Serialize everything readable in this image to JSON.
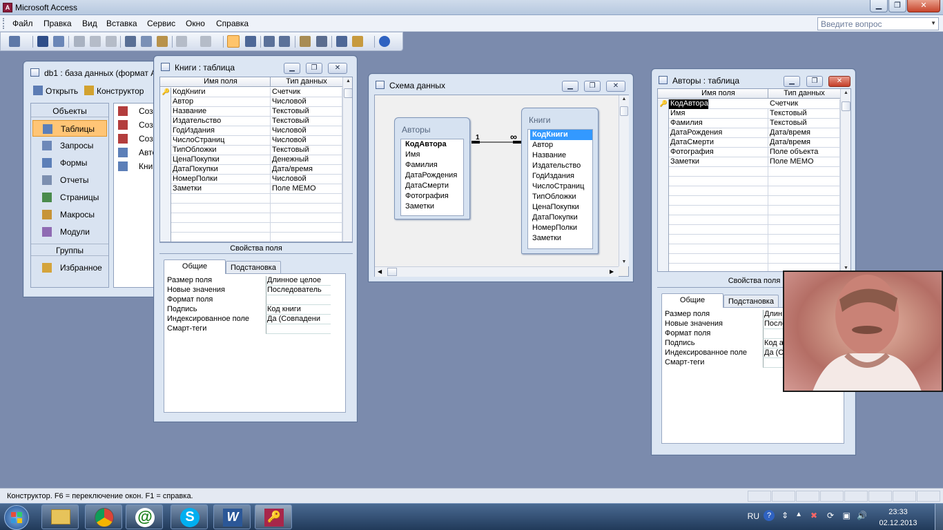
{
  "app": {
    "title": "Microsoft Access",
    "help_placeholder": "Введите вопрос"
  },
  "menu": [
    "Файл",
    "Правка",
    "Вид",
    "Вставка",
    "Сервис",
    "Окно",
    "Справка"
  ],
  "db_window": {
    "title": "db1 : база данных (формат Ac",
    "open_label": "Открыть",
    "designer_label": "Конструктор",
    "objects_header": "Объекты",
    "objects": [
      "Таблицы",
      "Запросы",
      "Формы",
      "Отчеты",
      "Страницы",
      "Макросы",
      "Модули"
    ],
    "groups_header": "Группы",
    "favorites": "Избранное",
    "list_items": [
      "Соз",
      "Соз",
      "Соз",
      "Авто",
      "Книг"
    ]
  },
  "books_window": {
    "title": "Книги : таблица",
    "col_field": "Имя поля",
    "col_type": "Тип данных",
    "rows": [
      {
        "name": "КодКниги",
        "type": "Счетчик"
      },
      {
        "name": "Автор",
        "type": "Числовой"
      },
      {
        "name": "Название",
        "type": "Текстовый"
      },
      {
        "name": "Издательство",
        "type": "Текстовый"
      },
      {
        "name": "ГодИздания",
        "type": "Числовой"
      },
      {
        "name": "ЧислоСтраниц",
        "type": "Числовой"
      },
      {
        "name": "ТипОбложки",
        "type": "Текстовый"
      },
      {
        "name": "ЦенаПокупки",
        "type": "Денежный"
      },
      {
        "name": "ДатаПокупки",
        "type": "Дата/время"
      },
      {
        "name": "НомерПолки",
        "type": "Числовой"
      },
      {
        "name": "Заметки",
        "type": "Поле MEMO"
      }
    ],
    "props_title": "Свойства поля",
    "tab_general": "Общие",
    "tab_lookup": "Подстановка",
    "props": [
      {
        "label": "Размер поля",
        "value": "Длинное целое"
      },
      {
        "label": "Новые значения",
        "value": "Последователь"
      },
      {
        "label": "Формат поля",
        "value": ""
      },
      {
        "label": "Подпись",
        "value": "Код книги"
      },
      {
        "label": "Индексированное поле",
        "value": "Да (Совпадени"
      },
      {
        "label": "Смарт-теги",
        "value": ""
      }
    ]
  },
  "schema_window": {
    "title": "Схема данных",
    "authors_table": "Авторы",
    "authors_fields": [
      "КодАвтора",
      "Имя",
      "Фамилия",
      "ДатаРождения",
      "ДатаСмерти",
      "Фотография",
      "Заметки"
    ],
    "books_table": "Книги",
    "books_fields": [
      "КодКниги",
      "Автор",
      "Название",
      "Издательство",
      "ГодИздания",
      "ЧислоСтраниц",
      "ТипОбложки",
      "ЦенаПокупки",
      "ДатаПокупки",
      "НомерПолки",
      "Заметки"
    ],
    "rel_one": "1",
    "rel_many": "∞"
  },
  "authors_window": {
    "title": "Авторы : таблица",
    "col_field": "Имя поля",
    "col_type": "Тип данных",
    "rows": [
      {
        "name": "КодАвтора",
        "type": "Счетчик"
      },
      {
        "name": "Имя",
        "type": "Текстовый"
      },
      {
        "name": "Фамилия",
        "type": "Текстовый"
      },
      {
        "name": "ДатаРождения",
        "type": "Дата/время"
      },
      {
        "name": "ДатаСмерти",
        "type": "Дата/время"
      },
      {
        "name": "Фотография",
        "type": "Поле объекта"
      },
      {
        "name": "Заметки",
        "type": "Поле MEMO"
      }
    ],
    "props_title": "Свойства поля",
    "tab_general": "Общие",
    "tab_lookup": "Подстановка",
    "props": [
      {
        "label": "Размер поля",
        "value": "Длин"
      },
      {
        "label": "Новые значения",
        "value": "После"
      },
      {
        "label": "Формат поля",
        "value": ""
      },
      {
        "label": "Подпись",
        "value": "Код а"
      },
      {
        "label": "Индексированное поле",
        "value": "Да (С"
      },
      {
        "label": "Смарт-теги",
        "value": ""
      }
    ]
  },
  "status": {
    "text": "Конструктор.  F6 = переключение окон.  F1 = справка."
  },
  "tray": {
    "lang": "RU",
    "time": "23:33",
    "date": "02.12.2013"
  },
  "taskbar_apps": [
    "explorer-icon",
    "chrome-icon",
    "mail-agent-icon",
    "skype-icon",
    "word-icon",
    "access-icon"
  ]
}
